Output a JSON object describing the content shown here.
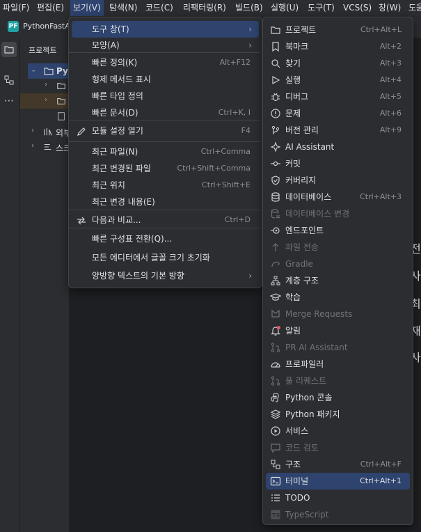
{
  "menubar": {
    "items": [
      "파일(F)",
      "편집(E)",
      "보기(V)",
      "탐색(N)",
      "코드(C)",
      "리팩터링(R)",
      "빌드(B)",
      "실행(U)",
      "도구(T)",
      "VCS(S)",
      "창(W)",
      "도움"
    ]
  },
  "project": {
    "name": "PythonFastAPI",
    "icon_text": "PF"
  },
  "panel": {
    "title": "프로젝트",
    "tree": [
      "Pyt",
      "외부",
      "스크"
    ]
  },
  "editor_snippets": [
    "전체",
    "사업",
    "최근",
    "재파",
    "사업"
  ],
  "view_menu": {
    "items": [
      {
        "label": "도구 창(T)",
        "shortcut": "",
        "submenu": true,
        "selected": true
      },
      {
        "label": "모양(A)",
        "shortcut": "",
        "submenu": true
      },
      {
        "label": "빠른 정의(K)",
        "shortcut": "Alt+F12"
      },
      {
        "label": "형제 메서드 표시",
        "shortcut": ""
      },
      {
        "label": "빠른 타입 정의",
        "shortcut": ""
      },
      {
        "label": "빠른 문서(D)",
        "shortcut": "Ctrl+K, I"
      },
      {
        "label": "모듈 설정 열기",
        "shortcut": "F4",
        "icon": "pencil-icon"
      },
      {
        "label": "최근 파일(N)",
        "shortcut": "Ctrl+Comma"
      },
      {
        "label": "최근 변경된 파일",
        "shortcut": "Ctrl+Shift+Comma"
      },
      {
        "label": "최근 위치",
        "shortcut": "Ctrl+Shift+E"
      },
      {
        "label": "최근 변경 내용(E)",
        "shortcut": ""
      },
      {
        "label": "다음과 비교...",
        "shortcut": "Ctrl+D",
        "icon": "compare-icon"
      },
      {
        "label": "빠른 구성표 전환(Q)...",
        "shortcut": ""
      },
      {
        "label": "모든 에디터에서 글꼴 크기 초기화",
        "shortcut": ""
      },
      {
        "label": "양방향 텍스트의 기본 방향",
        "shortcut": "",
        "submenu": true
      }
    ]
  },
  "tool_windows_menu": {
    "items": [
      {
        "label": "프로젝트",
        "shortcut": "Ctrl+Alt+L",
        "icon": "folder-icon"
      },
      {
        "label": "북마크",
        "shortcut": "Alt+2",
        "icon": "bookmark-icon"
      },
      {
        "label": "찾기",
        "shortcut": "Alt+3",
        "icon": "search-icon"
      },
      {
        "label": "실행",
        "shortcut": "Alt+4",
        "icon": "run-icon"
      },
      {
        "label": "디버그",
        "shortcut": "Alt+5",
        "icon": "bug-icon"
      },
      {
        "label": "문제",
        "shortcut": "Alt+6",
        "icon": "warning-icon"
      },
      {
        "label": "버전 관리",
        "shortcut": "Alt+9",
        "icon": "vcs-icon"
      },
      {
        "label": "AI Assistant",
        "shortcut": "",
        "icon": "ai-icon"
      },
      {
        "label": "커밋",
        "shortcut": "",
        "icon": "commit-icon"
      },
      {
        "label": "커버리지",
        "shortcut": "",
        "icon": "shield-icon"
      },
      {
        "label": "데이터베이스",
        "shortcut": "Ctrl+Alt+3",
        "icon": "database-icon"
      },
      {
        "label": "데이터베이스 변경",
        "shortcut": "",
        "icon": "database-changes-icon",
        "disabled": true
      },
      {
        "label": "엔드포인트",
        "shortcut": "",
        "icon": "endpoint-icon"
      },
      {
        "label": "파일 전송",
        "shortcut": "",
        "icon": "file-transfer-icon",
        "disabled": true
      },
      {
        "label": "Gradle",
        "shortcut": "",
        "icon": "gradle-icon",
        "disabled": true
      },
      {
        "label": "계층 구조",
        "shortcut": "",
        "icon": "hierarchy-icon"
      },
      {
        "label": "학습",
        "shortcut": "",
        "icon": "learn-icon"
      },
      {
        "label": "Merge Requests",
        "shortcut": "",
        "icon": "merge-request-icon",
        "disabled": true
      },
      {
        "label": "알림",
        "shortcut": "",
        "icon": "bell-icon"
      },
      {
        "label": "PR AI Assistant",
        "shortcut": "",
        "icon": "pr-ai-icon",
        "disabled": true
      },
      {
        "label": "프로파일러",
        "shortcut": "",
        "icon": "profiler-icon"
      },
      {
        "label": "풀 리퀘스트",
        "shortcut": "",
        "icon": "pull-request-icon",
        "disabled": true
      },
      {
        "label": "Python 콘솔",
        "shortcut": "",
        "icon": "python-console-icon"
      },
      {
        "label": "Python 패키지",
        "shortcut": "",
        "icon": "packages-icon"
      },
      {
        "label": "서비스",
        "shortcut": "",
        "icon": "services-icon"
      },
      {
        "label": "코드 검토",
        "shortcut": "",
        "icon": "code-review-icon",
        "disabled": true
      },
      {
        "label": "구조",
        "shortcut": "Ctrl+Alt+F",
        "icon": "structure-icon"
      },
      {
        "label": "터미널",
        "shortcut": "Ctrl+Alt+1",
        "icon": "terminal-icon",
        "selected": true
      },
      {
        "label": "TODO",
        "shortcut": "",
        "icon": "todo-icon"
      },
      {
        "label": "TypeScript",
        "shortcut": "",
        "icon": "typescript-icon",
        "disabled": true
      }
    ]
  }
}
